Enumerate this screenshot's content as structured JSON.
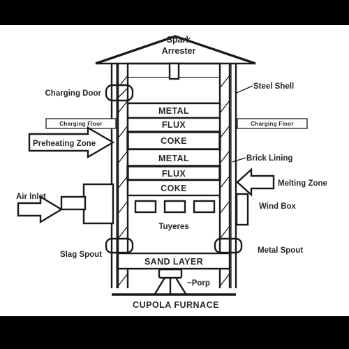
{
  "diagram": {
    "title": "CUPOLA FURNACE",
    "top_label": {
      "line1": "Spark",
      "line2": "Arrester"
    },
    "charge_layers": [
      "METAL",
      "FLUX",
      "COKE",
      "METAL",
      "FLUX",
      "COKE"
    ],
    "left_labels": {
      "charging_door": "Charging Door",
      "charging_floor": "Charging Floor",
      "preheating_zone": "Preheating Zone",
      "air_inlet": "Air Inlet",
      "slag_spout": "Slag Spout"
    },
    "right_labels": {
      "steel_shell": "Steel Shell",
      "charging_floor": "Charging Floor",
      "brick_lining": "Brick Lining",
      "melting_zone": "Melting Zone",
      "wind_box": "Wind Box",
      "metal_spout": "Metal Spout"
    },
    "interior_labels": {
      "tuyeres": "Tuyeres",
      "sand_layer": "SAND LAYER",
      "prop": "~Porp"
    },
    "colors": {
      "line": "#1a1a1a",
      "text": "#26262e",
      "background": "#ffffff",
      "letterbox": "#000000"
    }
  }
}
